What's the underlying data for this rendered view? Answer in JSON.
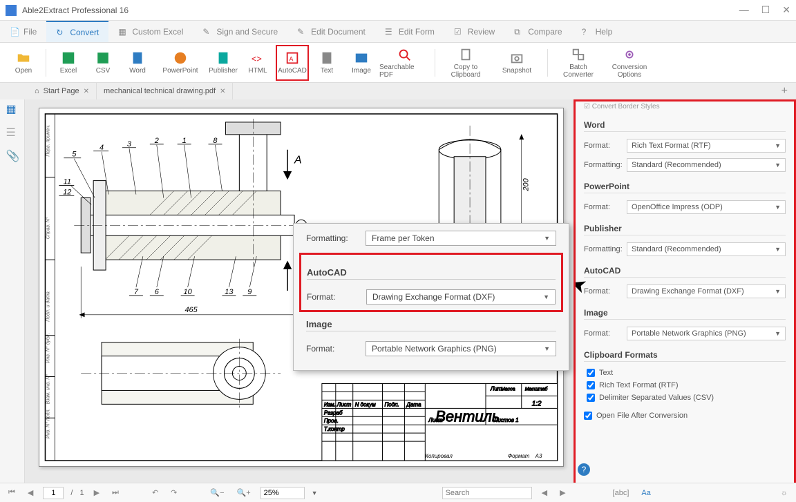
{
  "titlebar": {
    "title": "Able2Extract Professional 16"
  },
  "menu": {
    "items": [
      "File",
      "Convert",
      "Custom Excel",
      "Sign and Secure",
      "Edit Document",
      "Edit Form",
      "Review",
      "Compare",
      "Help"
    ],
    "active_index": 1
  },
  "toolbar": {
    "open": "Open",
    "excel": "Excel",
    "csv": "CSV",
    "word": "Word",
    "powerpoint": "PowerPoint",
    "publisher": "Publisher",
    "html": "HTML",
    "autocad": "AutoCAD",
    "text": "Text",
    "image": "Image",
    "searchable_pdf": "Searchable PDF",
    "copy_to_clipboard": "Copy to\nClipboard",
    "snapshot": "Snapshot",
    "batch_converter": "Batch\nConverter",
    "conversion_options": "Conversion\nOptions"
  },
  "tabs": {
    "start": "Start Page",
    "doc": "mechanical technical drawing.pdf"
  },
  "popup": {
    "formatting_label": "Formatting:",
    "formatting_value": "Frame per Token",
    "autocad_section": "AutoCAD",
    "format_label": "Format:",
    "format_value": "Drawing Exchange Format (DXF)",
    "image_section": "Image",
    "image_format_label": "Format:",
    "image_format_value": "Portable Network Graphics (PNG)"
  },
  "panel": {
    "header_fragment": "Convert Border Styles",
    "word_section": "Word",
    "word_format_label": "Format:",
    "word_format_value": "Rich Text Format (RTF)",
    "word_formatting_label": "Formatting:",
    "word_formatting_value": "Standard (Recommended)",
    "ppt_section": "PowerPoint",
    "ppt_format_label": "Format:",
    "ppt_format_value": "OpenOffice Impress (ODP)",
    "publisher_section": "Publisher",
    "publisher_formatting_label": "Formatting:",
    "publisher_formatting_value": "Standard (Recommended)",
    "autocad_section_frag": "AutoCAD",
    "autocad_format_label": "Format:",
    "autocad_format_value": "Drawing Exchange Format (DXF)",
    "image_section_frag": "Image",
    "image_format_label": "Format:",
    "image_format_value": "Portable Network Graphics (PNG)",
    "clipboard_section": "Clipboard Formats",
    "cb_text": "Text",
    "cb_rtf": "Rich Text Format (RTF)",
    "cb_csv": "Delimiter Separated Values (CSV)",
    "open_after": "Open File After Conversion"
  },
  "drawing": {
    "title_block_text": "Вентиль",
    "title_n_docum": "N докум",
    "title_podp": "Подп.",
    "title_data": "Дата",
    "title_izm": "Изм.",
    "title_list": "Лист",
    "title_razrab": "Разраб",
    "title_prov": "Пров.",
    "title_tkontr": "Т.контр",
    "title_lit": "Лит.",
    "title_massa": "Масса",
    "title_masshtab": "Масштаб",
    "title_scale": "1:2",
    "title_listov": "Листов  1",
    "title_kopiroval": "Копировал",
    "title_format": "Формат",
    "title_format_val": "A3",
    "dim_465": "465",
    "dim_200": "200",
    "callouts": [
      "1",
      "2",
      "3",
      "4",
      "5",
      "6",
      "7",
      "8",
      "9",
      "10",
      "11",
      "12",
      "13"
    ],
    "A_label": "A"
  },
  "statusbar": {
    "page_current": "1",
    "page_sep": "/",
    "page_total": "1",
    "zoom": "25%",
    "search_placeholder": "Search"
  }
}
